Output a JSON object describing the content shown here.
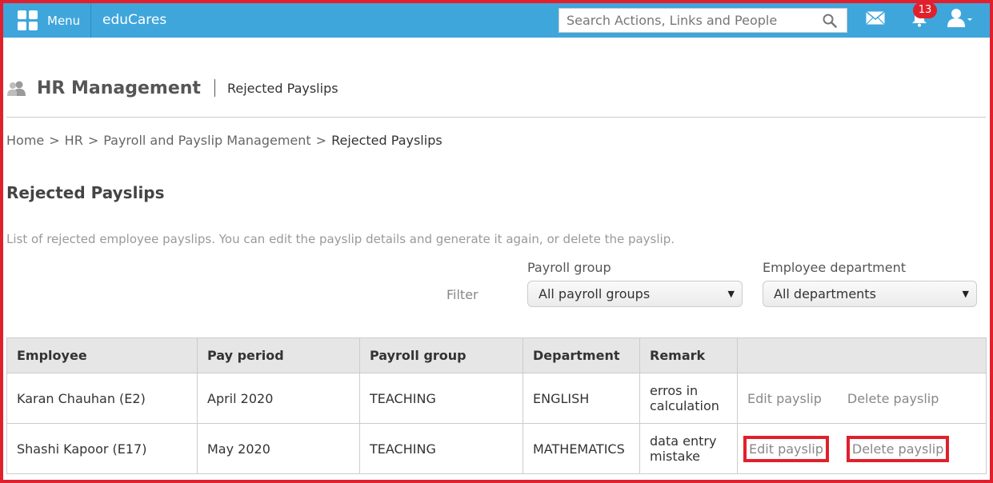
{
  "topbar": {
    "menu_label": "Menu",
    "brand": "eduCares",
    "search_placeholder": "Search Actions, Links and People",
    "notification_count": "13"
  },
  "header": {
    "module": "HR Management",
    "page": "Rejected Payslips"
  },
  "breadcrumb": {
    "items": [
      "Home",
      "HR",
      "Payroll and Payslip Management"
    ],
    "current": "Rejected Payslips",
    "separator": ">"
  },
  "main": {
    "title": "Rejected Payslips",
    "description": "List of rejected employee payslips. You can edit the payslip details and generate it again, or delete the payslip.",
    "filter_label": "Filter",
    "payroll_group_label": "Payroll group",
    "payroll_group_value": "All payroll groups",
    "department_label": "Employee department",
    "department_value": "All departments"
  },
  "table": {
    "headers": [
      "Employee",
      "Pay period",
      "Payroll group",
      "Department",
      "Remark",
      ""
    ],
    "rows": [
      {
        "employee": "Karan Chauhan (E2)",
        "pay_period": "April 2020",
        "payroll_group": "TEACHING",
        "department": "ENGLISH",
        "remark": "erros in calculation",
        "edit": "Edit payslip",
        "delete": "Delete payslip"
      },
      {
        "employee": "Shashi Kapoor (E17)",
        "pay_period": "May 2020",
        "payroll_group": "TEACHING",
        "department": "MATHEMATICS",
        "remark": "data entry mistake",
        "edit": "Edit payslip",
        "delete": "Delete payslip"
      }
    ]
  },
  "colors": {
    "topbar": "#3fa6dc",
    "highlight": "#e0202c"
  }
}
